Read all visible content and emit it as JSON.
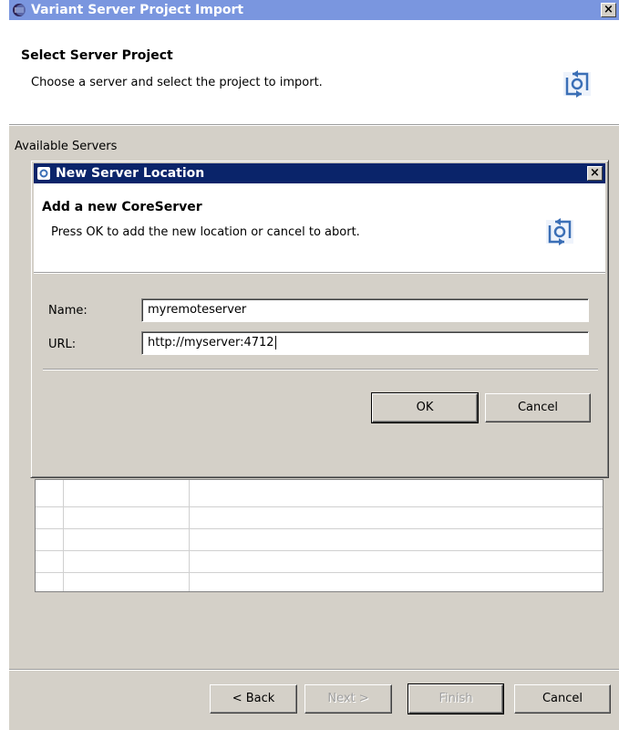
{
  "main_window": {
    "title": "Variant Server Project Import",
    "close_glyph": "×",
    "header_title": "Select Server Project",
    "header_desc": "Choose a server and select the project to import.",
    "available_servers_label": "Available Servers",
    "buttons": {
      "back": "< Back",
      "next": "Next >",
      "finish": "Finish",
      "cancel": "Cancel"
    }
  },
  "dialog": {
    "title": "New Server Location",
    "close_glyph": "×",
    "header_title": "Add a new CoreServer",
    "header_desc": "Press OK to add the new location or cancel to abort.",
    "name_label": "Name:",
    "name_value": "myremoteserver",
    "url_label": "URL:",
    "url_value": "http://myserver:4712",
    "ok": "OK",
    "cancel": "Cancel"
  },
  "colors": {
    "main_titlebar": "#7a96df",
    "dialog_titlebar": "#0a246a",
    "dialog_bg": "#d4d0c8"
  },
  "icons": [
    "eclipse-icon",
    "server-sync-icon",
    "close-icon"
  ]
}
